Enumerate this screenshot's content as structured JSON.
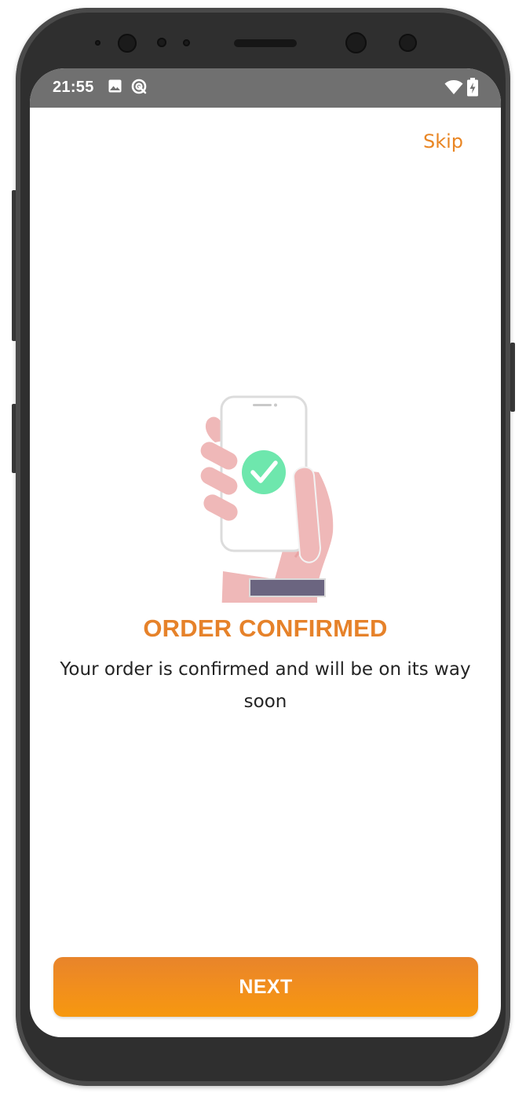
{
  "status_bar": {
    "time": "21:55",
    "icons": [
      "image-icon",
      "sync-icon",
      "wifi-icon",
      "battery-charging-icon"
    ]
  },
  "header": {
    "skip_label": "Skip"
  },
  "illustration": {
    "icon": "hand-holding-phone-check-icon"
  },
  "content": {
    "title": "ORDER CONFIRMED",
    "message": "Your order is confirmed and will be on its way soon"
  },
  "footer": {
    "next_label": "NEXT"
  },
  "colors": {
    "accent": "#e98624",
    "button": "#f28f1c",
    "check": "#6ee7ad",
    "hand": "#efb8b8",
    "sleeve": "#6b6580",
    "status_bar": "#707070"
  }
}
